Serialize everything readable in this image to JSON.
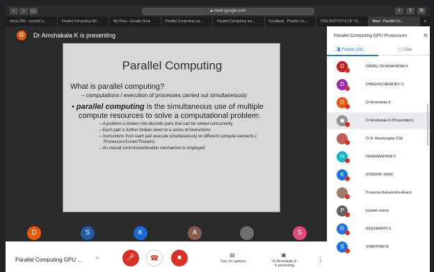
{
  "browser": {
    "url": "meet.google.com",
    "tabs": [
      "Inbox (38) - sumathi a...",
      "Parallel Computing GP...",
      "My Drive - Google Drive",
      "Parallel Computing usi...",
      "Parallel Computing usi...",
      "Feedback - Parallel Co...",
      "PSG INSTITUTE OF TE...",
      "Meet - Parallel Co..."
    ]
  },
  "meeting": {
    "presenter_avatar": "D",
    "presenter_text": "Dr Amshakala K is presenting",
    "name": "Parallel Computing GPU ...",
    "captions_label": "Turn on captions",
    "presenting_label_1": "Dr Amshakala K",
    "presenting_label_2": "is presenting",
    "tiles": [
      {
        "letter": "D",
        "color": "#e8590c"
      },
      {
        "letter": "S",
        "color": "#1e5ba8"
      },
      {
        "letter": "K",
        "color": "#1967d2"
      },
      {
        "letter": "A",
        "color": "#8d5a4a"
      },
      {
        "letter": "",
        "color": "#6f6f6f"
      },
      {
        "letter": "S",
        "color": "#e14b7b"
      }
    ]
  },
  "slide": {
    "title": "Parallel Computing",
    "question": "What is parallel computing?",
    "dash_1": "– computations / execution of processes carried out simultaneously",
    "bullet_bold": "parallel computing",
    "bullet_rest": " is the simultaneous use of multiple compute resources to solve a computational problem:",
    "sub": [
      "– A problem is broken into discrete parts that can be solved concurrently",
      "– Each part is further broken down to a series of instructions",
      "– Instructions from each part execute simultaneously on different compute elements ( Processors/Cores/Threads)",
      "– An overall control/coordination mechanism is employed"
    ]
  },
  "panel": {
    "title": "Parallel Computing GPU Processors",
    "people_tab": "People (16)",
    "chat_tab": "Chat",
    "people": [
      {
        "name": "DANIEL DEVASAHAYAM A",
        "initial": "D",
        "color": "#c5221f"
      },
      {
        "name": "DHEEKACHANADEVI S",
        "initial": "D",
        "color": "#9c27b0"
      },
      {
        "name": "Dr Amshakala K",
        "initial": "D",
        "color": "#e8590c"
      },
      {
        "name": "Dr Amshakala K (Presentation)",
        "initial": "▣",
        "color": "#8f8f8f"
      },
      {
        "name": "Dr R. Manimegalai CSE",
        "initial": "",
        "color": "#c45a5a"
      },
      {
        "name": "HEMANANDHINI K",
        "initial": "H",
        "color": "#12b5cb"
      },
      {
        "name": "KOWSHIK SMKK",
        "initial": "K",
        "color": "#1a73e8"
      },
      {
        "name": "Prasanna Rahavendra Anand",
        "initial": "",
        "color": "#9b7b68"
      },
      {
        "name": "praveen kumar",
        "initial": "P",
        "color": "#5f6368"
      },
      {
        "name": "RASSWANTH S",
        "initial": "R",
        "color": "#1a73e8"
      },
      {
        "name": "SHANTHINI M",
        "initial": "S",
        "color": "#1a73e8"
      }
    ]
  }
}
